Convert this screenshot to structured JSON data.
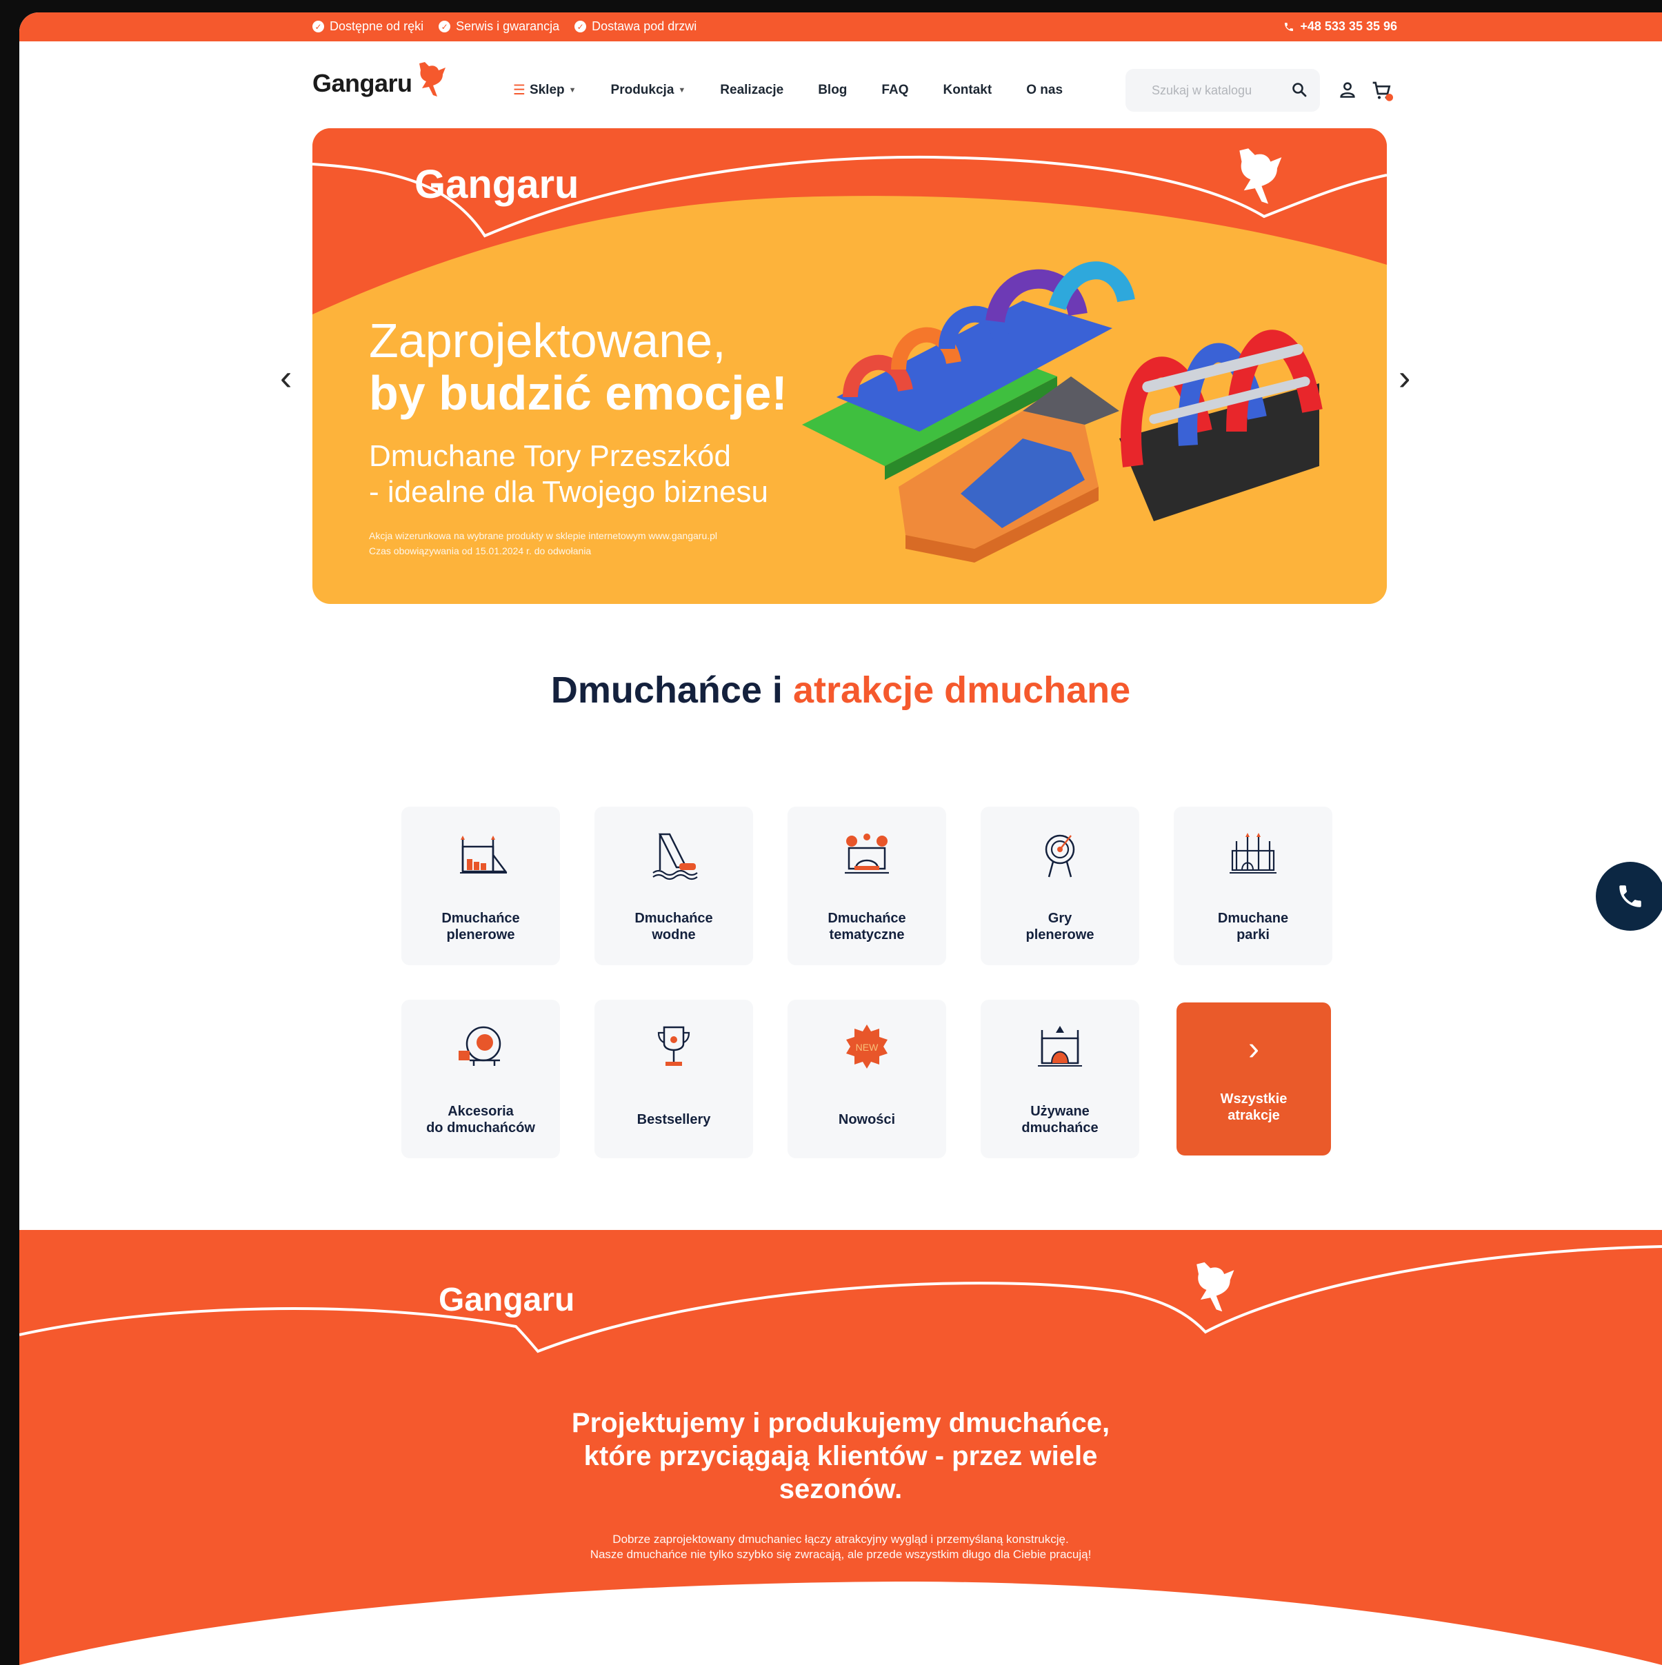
{
  "topbar": {
    "perks": [
      "Dostępne od ręki",
      "Serwis i gwarancja",
      "Dostawa pod drzwi"
    ],
    "phone": "+48 533 35 35 96"
  },
  "header": {
    "logo": "Gangaru",
    "nav": [
      {
        "label": "Sklep",
        "burger": true,
        "dropdown": true
      },
      {
        "label": "Produkcja",
        "dropdown": true
      },
      {
        "label": "Realizacje"
      },
      {
        "label": "Blog"
      },
      {
        "label": "FAQ"
      },
      {
        "label": "Kontakt"
      },
      {
        "label": "O nas"
      }
    ],
    "search_placeholder": "Szukaj w katalogu"
  },
  "hero": {
    "logo": "Gangaru",
    "headline_light": "Zaprojektowane,",
    "headline_bold": "by budzić emocje!",
    "subhead_line1": "Dmuchane Tory Przeszkód",
    "subhead_line2": "- idealne dla Twojego biznesu",
    "fineprint_line1": "Akcja wizerunkowa na wybrane produkty w sklepie internetowym www.gangaru.pl",
    "fineprint_line2": "Czas obowiązywania od 15.01.2024 r. do odwołania"
  },
  "section": {
    "title_dark": "Dmuchańce i ",
    "title_accent": "atrakcje dmuchane"
  },
  "tiles": [
    {
      "label": "Dmuchańce\nplenerowe"
    },
    {
      "label": "Dmuchańce\nwodne"
    },
    {
      "label": "Dmuchańce\ntematyczne"
    },
    {
      "label": "Gry\nplenerowe"
    },
    {
      "label": "Dmuchane\nparki"
    },
    {
      "label": "Akcesoria\ndo dmuchańców"
    },
    {
      "label": "Bestsellery"
    },
    {
      "label": "Nowości"
    },
    {
      "label": "Używane\ndmuchańce"
    },
    {
      "label": "Wszystkie\natrakcje"
    }
  ],
  "bottom": {
    "logo": "Gangaru",
    "title": "Projektujemy i produkujemy dmuchańce,\nktóre przyciągają klientów - przez wiele\nsezonów.",
    "text": "Dobrze zaprojektowany dmuchaniec łączy atrakcyjny wygląd i przemyślaną konstrukcję.\nNasze dmuchańce nie tylko szybko się zwracają, ale przede wszystkim długo dla Ciebie pracują!"
  },
  "colors": {
    "accent": "#f5592d",
    "navy": "#14213d",
    "hero_bg": "#fdb33b"
  }
}
